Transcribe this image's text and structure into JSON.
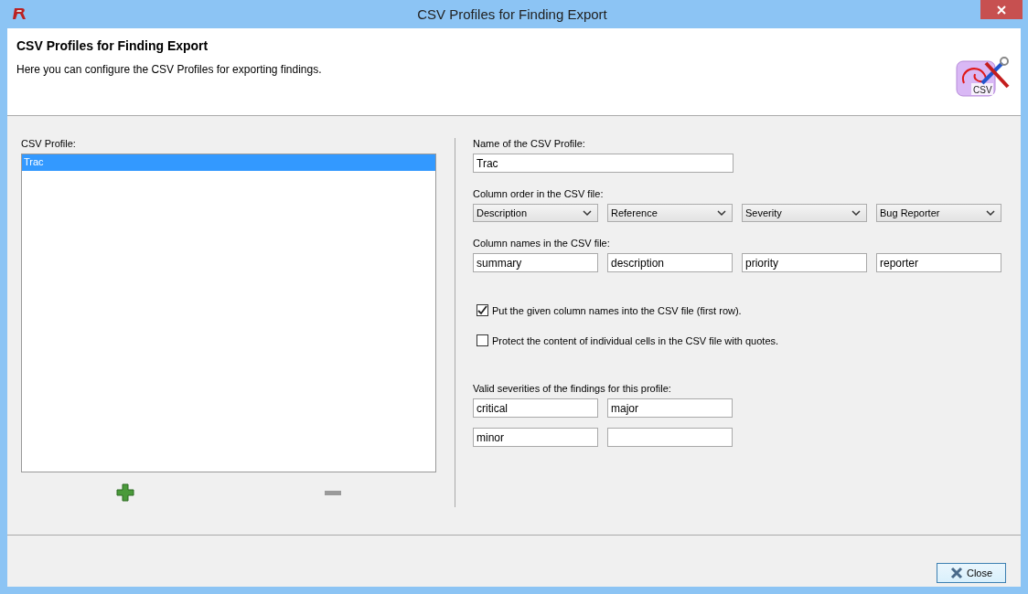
{
  "window": {
    "title": "CSV Profiles for Finding Export"
  },
  "header": {
    "title": "CSV Profiles for Finding Export",
    "description": "Here you can configure the CSV Profiles for exporting findings.",
    "logo_text": "CSV"
  },
  "profiles": {
    "label": "CSV Profile:",
    "items": [
      {
        "name": "Trac",
        "selected": true
      }
    ]
  },
  "list_buttons": [
    {
      "kind": "add",
      "disabled": false
    },
    {
      "kind": "remove",
      "disabled": true
    }
  ],
  "name_field": {
    "label": "Name of the CSV Profile:",
    "value": "Trac"
  },
  "column_order": {
    "label": "Column order in the CSV file:",
    "selects": [
      "Description",
      "Reference",
      "Severity",
      "Bug Reporter"
    ]
  },
  "column_names": {
    "label": "Column names in the CSV file:",
    "values": [
      "summary",
      "description",
      "priority",
      "reporter"
    ]
  },
  "options": [
    {
      "label": "Put the given column names into the CSV file (first row).",
      "checked": true
    },
    {
      "label": "Protect the content of individual cells in the CSV file with quotes.",
      "checked": false
    }
  ],
  "severities": {
    "label": "Valid severities of the findings for this profile:",
    "values": [
      "critical",
      "major",
      "minor"
    ]
  },
  "footer": {
    "close_label": "Close"
  }
}
